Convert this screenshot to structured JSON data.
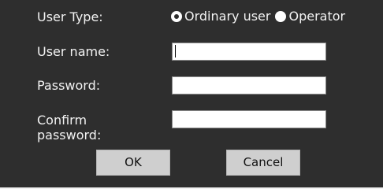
{
  "form": {
    "user_type_label": "User Type:",
    "user_type_options": [
      {
        "label": "Ordinary user",
        "selected": true
      },
      {
        "label": "Operator",
        "selected": false
      }
    ],
    "username_label": "User name:",
    "username_value": "",
    "password_label": "Password:",
    "password_value": "",
    "confirm_label": "Confirm password:",
    "confirm_value": ""
  },
  "buttons": {
    "ok": "OK",
    "cancel": "Cancel"
  },
  "colors": {
    "background": "#2e2e2e",
    "text": "#f2f2f2",
    "button": "#cfcfcf"
  }
}
